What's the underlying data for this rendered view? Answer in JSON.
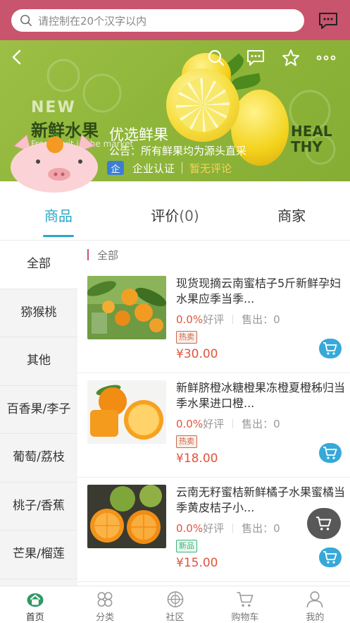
{
  "search": {
    "placeholder": "请控制在20个汉字以内"
  },
  "banner": {
    "new_text": "NEW",
    "fresh_text": "新鲜水果",
    "fresh_sub": "Fresh fruit in the market",
    "healthy": [
      "HEAL",
      "THY"
    ],
    "shop_name": "优选鲜果",
    "notice": "公告：所有鲜果均为源头直采",
    "cert_badge": "企",
    "cert_label": "企业认证",
    "review_label": "暂无评论"
  },
  "tabs": [
    {
      "label": "商品",
      "count": ""
    },
    {
      "label": "评价",
      "count": "(0)"
    },
    {
      "label": "商家",
      "count": ""
    }
  ],
  "categories": [
    "全部",
    "猕猴桃",
    "其他",
    "百香果/李子",
    "葡萄/荔枝",
    "桃子/香蕉",
    "芒果/榴莲"
  ],
  "list_header": "全部",
  "products": [
    {
      "title": "现货现摘云南蜜桔子5斤新鲜孕妇水果应季当季...",
      "rating": "0.0%",
      "rating_label": "好评",
      "sold_label": "售出：",
      "sold": "0",
      "tag": "热卖",
      "price": "¥30.00"
    },
    {
      "title": "新鲜脐橙冰糖橙果冻橙夏橙秭归当季水果进口橙...",
      "rating": "0.0%",
      "rating_label": "好评",
      "sold_label": "售出：",
      "sold": "0",
      "tag": "热卖",
      "price": "¥18.00"
    },
    {
      "title": "云南无籽蜜桔新鲜橘子水果蜜橘当季黄皮桔子小...",
      "rating": "0.0%",
      "rating_label": "好评",
      "sold_label": "售出：",
      "sold": "0",
      "tag": "新品",
      "price": "¥15.00"
    }
  ],
  "bottom_nav": [
    "首页",
    "分类",
    "社区",
    "购物车",
    "我的"
  ],
  "colors": {
    "brand": "#c9546e",
    "accent": "#2aa8c8",
    "price": "#e0543c",
    "cart": "#36a9d8"
  }
}
